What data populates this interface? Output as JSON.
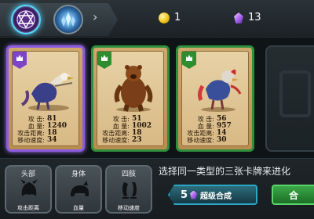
{
  "currency": {
    "gold": "1",
    "gems": "13"
  },
  "tabs": [
    {
      "icon": "hexagram-icon",
      "active": true
    },
    {
      "icon": "crystal-tower-icon",
      "active": false
    }
  ],
  "cards": [
    {
      "name": "dark-bird-knight",
      "rarity_color": "#7d44c9",
      "selected": true,
      "stats": [
        {
          "label": "攻  击:",
          "value": "81"
        },
        {
          "label": "血  量:",
          "value": "1240"
        },
        {
          "label": "攻击距离:",
          "value": "18"
        },
        {
          "label": "移动速度:",
          "value": "34"
        }
      ]
    },
    {
      "name": "brown-bear",
      "rarity_color": "#2e8d2f",
      "selected": false,
      "stats": [
        {
          "label": "攻  击:",
          "value": "51"
        },
        {
          "label": "血  量:",
          "value": "1002"
        },
        {
          "label": "攻击距离:",
          "value": "18"
        },
        {
          "label": "移动速度:",
          "value": "23"
        }
      ]
    },
    {
      "name": "red-bird-warrior",
      "rarity_color": "#2e8d2f",
      "selected": false,
      "stats": [
        {
          "label": "攻  击:",
          "value": "56"
        },
        {
          "label": "血  量:",
          "value": "957"
        },
        {
          "label": "攻击距离:",
          "value": "14"
        },
        {
          "label": "移动速度:",
          "value": "30"
        }
      ]
    }
  ],
  "slots": [
    {
      "title": "头部",
      "label": "攻击距离",
      "icon": "head-icon"
    },
    {
      "title": "身体",
      "label": "血量",
      "icon": "body-icon"
    },
    {
      "title": "四肢",
      "label": "移动速度",
      "icon": "limbs-icon"
    }
  ],
  "hint": "选择同一类型的三张卡牌来进化",
  "evolve": {
    "cost": "5",
    "label": "超级合成"
  },
  "merge": {
    "label": "合"
  }
}
